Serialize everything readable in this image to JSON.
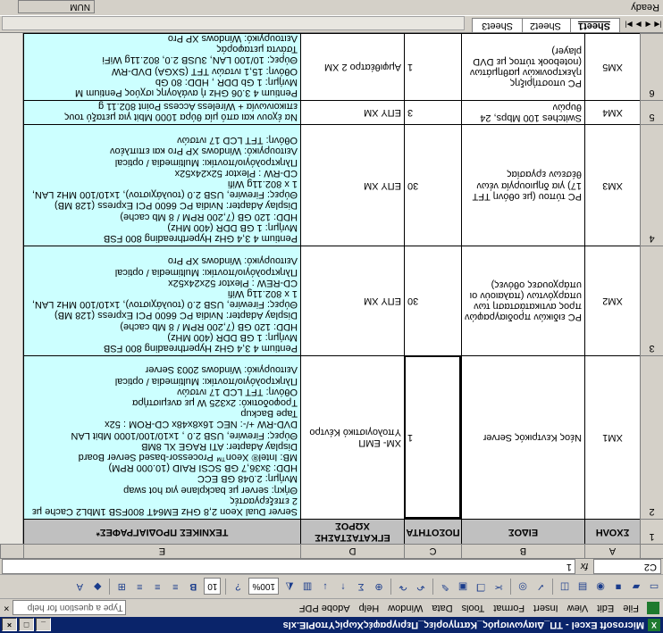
{
  "window": {
    "title": "Microsoft Excel - ΤΠ_Διαγωνισμός_Κατηγορίες_ΠεριγραφέςΧωρίςΥποΡΙΕ.xls",
    "app_icon": "excel-icon"
  },
  "menu": {
    "items": [
      "File",
      "Edit",
      "View",
      "Insert",
      "Format",
      "Tools",
      "Data",
      "Window",
      "Help",
      "Adobe PDF"
    ],
    "help_placeholder": "Type a question for help"
  },
  "toolbar": {
    "zoom": "100%",
    "font_size": "10"
  },
  "formula_bar": {
    "name_box": "C2",
    "fx": "fx",
    "content": "1"
  },
  "columns": [
    "A",
    "B",
    "C",
    "D",
    "E"
  ],
  "rows": [
    {
      "num": "1",
      "a": "ΣΧΟΛΗ",
      "b": "ΕΙΔΟΣ",
      "c": "ΠΟΣΟΤΗΤΑ",
      "d": "ΕΓΚΑΤΑΣΤΑΣΗΣ ΧΩΡΟΣ",
      "e": "ΤΕΧΝΙΚΕΣ ΠΡΟΔΙΑΓΡΑΦΕΣ*"
    },
    {
      "num": "2",
      "a": "ΧΜ1",
      "b": "Νέος Κεντρικός Server",
      "c": "1",
      "d": "ΧΜ- ΕΜΠ Υπολογιστικό Κέντρο",
      "e": "Server Dual Xeon 2,8 GHz EM64T 800FSB 1MbL2 Cache με 2 επεξεργαστές\nΘήκη: server με backplane για hot swap\nΜνήμη: 2.048 GB ECC\nHDD: 3x36,7 GB SCSI RAID (10.000 RPM)\nMB: Intel® Xeon™ Processor-based Server Board\nDisplay Adapter: ATI RAGE XL 8MB\nΘύρες: Firewire, USB 2.0 , 1x10/100/1000 Mbit LAN\nDVD-RW +/-: NEC 16x8x48x  CD-ROM : 52x\nTape Backup\nΤροφοδοτικό: 2x325 W με ανεμιστήρα\nΟθόνη: TFT LCD 17 ιντσών\nΠληκτρολόγιο/ποντίκι: Multimedia / optical\nΛειτουργικό: Windows 2003 Server"
    },
    {
      "num": "3",
      "a": "ΧΜ2",
      "b": "PC ειδικών προδιαγραφών προς αντικατάσταση των υπαρχόντων (παλαιούν οι υπάρχουσες οθόνες)",
      "c": "30",
      "d": "ΕΠΥ ΧΜ",
      "e": "Pentium 4 3,4 GHz Hyperthreading 800 FSB\nΜνήμη: 1 GB DDR (400 MHz)\nHDD: 120 GB  (7,200 RPM / 8 Mb cache)\nDisplay Adapter: Nvidia PC 6600 PCI Express (128 MB)\nΘύρες: Firewire, USB 2.0 (τουλάχιστον),  1x10/100 MHz  LAN, 1 x 802.11g Wifi\nCD-REW :  Plextor 52x24x52x\nΠληκτρολόγιο/ποντίκι: Multimedia / optical\nΛειτουργικό: Windows XP Pro"
    },
    {
      "num": "4",
      "a": "ΧΜ3",
      "b": "PC τύπου (με οθόνη TFT 17) για δημιουργία νέων θέσεων εργασίας",
      "c": "30",
      "d": "ΕΠΥ ΧΜ",
      "e": "Pentium 4 3,4 GHz Hyperthreading 800 FSB\nΜνήμη: 1 GB DDR (400 MHz)\nHDD: 120 GB  (7,200 RPM / 8 Mb cache)\nDisplay Adapter: Nvidia PC 6600 PCI Express (128 MB)\nΘύρες: Firewire, USB 2.0 (τουλάχιστον),  1x10/100 MHz  LAN, 1 x 802.11g Wifi\nCD-RW :  Plextor 52x24x52x\nΠληκτρολόγιο/ποντίκι: Multimedia / optical\nΛειτουργικό: Windows XP Pro        και επιπλέον\nΟθόνη: TFT LCD 17 ιντσών"
    },
    {
      "num": "5",
      "a": "ΧΜ4",
      "b": "Switches 100 Mbps, 24 θυρών",
      "c": "3",
      "d": "ΕΠΥ ΧΜ",
      "e": "Να έχουν και από μία θύρα 1000 Mbit για μεταξύ τους επικοινωνία + Wireless Access Point 802.11 g"
    },
    {
      "num": "6",
      "a": "ΧΜ5",
      "b": "PC υποστήριξης ηλεκτρονικών μαθημάτων (notebook τύπος με DVD player)",
      "c": "1",
      "d": "Αμφιθέατρο 2 ΧΜ",
      "e": "Pentium 4 3.06 GHz ή ανάλογης ισχύος Pentium M\nΜνήμη: 1 Gb DDR ,  HDD: 80 Gb\nΟθόνη: 15,1 ιντσών TFT (SXGA)  DVD-RW\nΘύρες: 10/100 LAN, 3USB 2.0, 802.11g WiFi\nΤσάντα μεταφοράς\nΛειτουργικό: Windows XP Pro"
    }
  ],
  "sheets": [
    "Sheet1",
    "Sheet2",
    "Sheet3"
  ],
  "status": {
    "left": "Ready",
    "num": "NUM"
  }
}
